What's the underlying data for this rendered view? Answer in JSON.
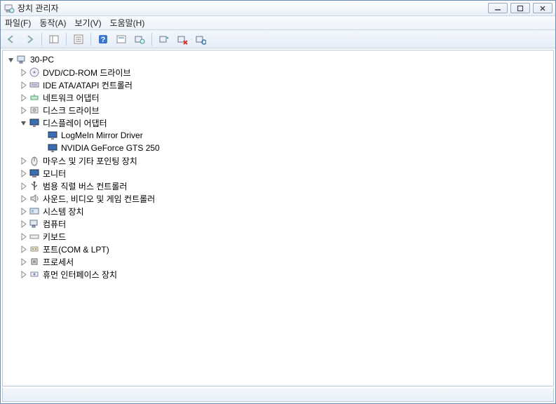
{
  "window": {
    "title": "장치 관리자"
  },
  "menu": {
    "file": "파일(F)",
    "action": "동작(A)",
    "view": "보기(V)",
    "help": "도움말(H)"
  },
  "tree": {
    "root": "30-PC",
    "nodes": [
      {
        "label": "DVD/CD-ROM 드라이브",
        "icon": "disc"
      },
      {
        "label": "IDE ATA/ATAPI 컨트롤러",
        "icon": "ide"
      },
      {
        "label": "네트워크 어댑터",
        "icon": "network"
      },
      {
        "label": "디스크 드라이브",
        "icon": "disk"
      },
      {
        "label": "디스플레이 어댑터",
        "icon": "display",
        "expanded": true,
        "children": [
          {
            "label": "LogMeIn Mirror Driver",
            "icon": "display"
          },
          {
            "label": "NVIDIA GeForce GTS 250",
            "icon": "display"
          }
        ]
      },
      {
        "label": "마우스 및 기타 포인팅 장치",
        "icon": "mouse"
      },
      {
        "label": "모니터",
        "icon": "monitor"
      },
      {
        "label": "범용 직렬 버스 컨트롤러",
        "icon": "usb"
      },
      {
        "label": "사운드, 비디오 및 게임 컨트롤러",
        "icon": "sound"
      },
      {
        "label": "시스템 장치",
        "icon": "system"
      },
      {
        "label": "컴퓨터",
        "icon": "computer"
      },
      {
        "label": "키보드",
        "icon": "keyboard"
      },
      {
        "label": "포트(COM & LPT)",
        "icon": "port"
      },
      {
        "label": "프로세서",
        "icon": "cpu"
      },
      {
        "label": "휴먼 인터페이스 장치",
        "icon": "hid"
      }
    ]
  }
}
